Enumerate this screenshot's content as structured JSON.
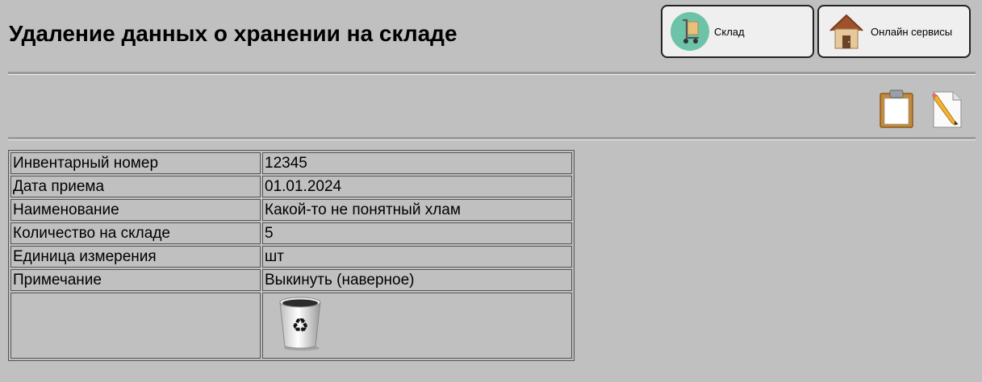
{
  "header": {
    "title": "Удаление данных о хранении на складе"
  },
  "nav": {
    "sklad_label": "Склад",
    "online_label": "Онлайн сервисы"
  },
  "toolbar": {
    "icons": [
      "clipboard-icon",
      "edit-document-icon"
    ]
  },
  "record": {
    "rows": [
      {
        "label": "Инвентарный номер",
        "value": "12345"
      },
      {
        "label": "Дата приема",
        "value": "01.01.2024"
      },
      {
        "label": "Наименование",
        "value": "Какой-то не понятный хлам"
      },
      {
        "label": "Количество на складе",
        "value": "5"
      },
      {
        "label": "Единица измерения",
        "value": "шт"
      },
      {
        "label": "Примечание",
        "value": "Выкинуть (наверное)"
      }
    ],
    "delete_icon": "recycle-bin-icon"
  },
  "colors": {
    "background": "#c0c0c0",
    "button_bg": "#efefef",
    "sklad_icon_bg": "#6cc3a8"
  }
}
